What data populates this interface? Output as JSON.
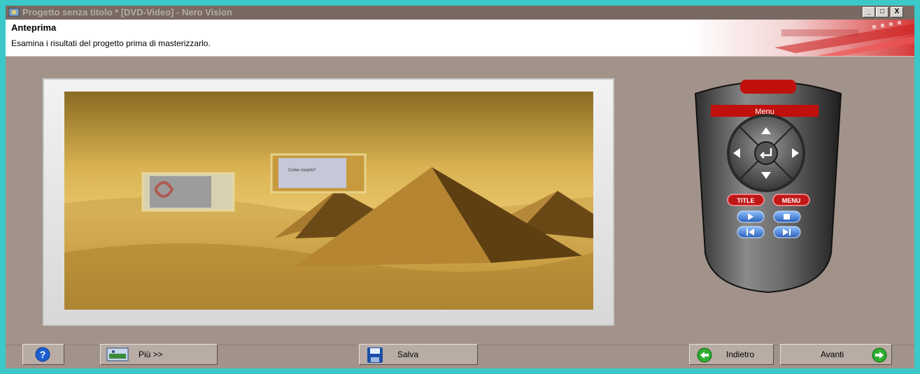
{
  "window": {
    "title": "Progetto senza titolo * [DVD-Video] - Nero Vision",
    "minimize": "_",
    "maximize": "□",
    "close": "X"
  },
  "header": {
    "title": "Anteprima",
    "subtitle": "Esamina i risultati del progetto prima di masterizzarlo."
  },
  "preview": {
    "thumb_text": "Come crearlo?"
  },
  "remote": {
    "display": "Menu",
    "title_button": "TITLE",
    "menu_button": "MENU"
  },
  "buttons": {
    "more": "Più >>",
    "save": "Salva",
    "back": "Indietro",
    "next": "Avanti"
  },
  "colors": {
    "accent": "#3cc8c8",
    "window_bg": "#a2938a",
    "remote_red": "#c0100c"
  }
}
